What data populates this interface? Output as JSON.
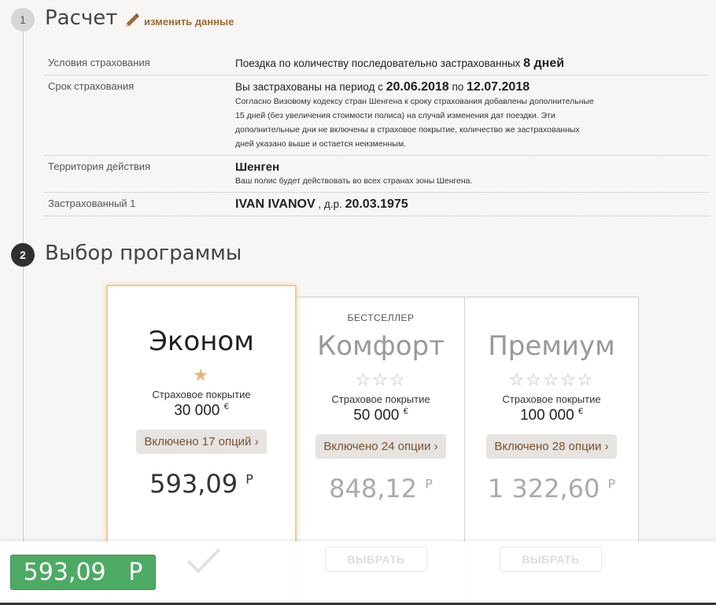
{
  "step1": {
    "number": "1",
    "title": "Расчет",
    "edit_label": "изменить данные"
  },
  "info": {
    "conditions": {
      "label": "Условия страхования",
      "text": "Поездка по количеству последовательно застрахованных",
      "days": "8 дней"
    },
    "period": {
      "label": "Срок страхования",
      "prefix": "Вы застрахованы на период с",
      "from": "20.06.2018",
      "mid": "по",
      "to": "12.07.2018",
      "note": "Согласно Визовому кодексу стран Шенгена к сроку страхования добавлены дополнительные 15 дней (без увеличения стоимости полиса) на случай изменения дат поездки. Эти дополнительные дни не включены в страховое покрытие, количество же застрахованных дней указано выше и остается неизменным."
    },
    "territory": {
      "label": "Территория действия",
      "value": "Шенген",
      "note": "Ваш полис будет действовать во всех странах зоны Шенгена."
    },
    "insured": {
      "label": "Застрахованный 1",
      "name": "IVAN IVANOV",
      "dob_label": ", д.р.",
      "dob": "20.03.1975"
    }
  },
  "step2": {
    "number": "2",
    "title": "Выбор программы"
  },
  "programs": [
    {
      "badge": "",
      "name": "Эконом",
      "stars_filled": 1,
      "stars_total": 1,
      "coverage_label": "Страховое покрытие",
      "coverage": "30 000",
      "currency": "€",
      "options": "Включено 17 опций ›",
      "price": "593,09",
      "price_currency": "Р",
      "selected": true
    },
    {
      "badge": "БЕСТСЕЛЛЕР",
      "name": "Комфорт",
      "stars_filled": 0,
      "stars_total": 3,
      "coverage_label": "Страховое покрытие",
      "coverage": "50 000",
      "currency": "€",
      "options": "Включено 24 опции ›",
      "price": "848,12",
      "price_currency": "Р",
      "select_label": "ВЫБРАТЬ",
      "selected": false
    },
    {
      "badge": "",
      "name": "Премиум",
      "stars_filled": 0,
      "stars_total": 5,
      "coverage_label": "Страховое покрытие",
      "coverage": "100 000",
      "currency": "€",
      "options": "Включено 28 опции ›",
      "price": "1 322,60",
      "price_currency": "Р",
      "select_label": "ВЫБРАТЬ",
      "selected": false
    }
  ],
  "total": {
    "amount": "593,09",
    "currency": "Р"
  },
  "icons": {
    "edit": "pencil-icon",
    "selected": "check-icon",
    "star_full": "star-filled-icon",
    "star_empty": "star-outline-icon"
  },
  "colors": {
    "accent": "#9b6a37",
    "total_bg": "#4daa64",
    "star": "#e7b575",
    "selected_border": "#f0c99a"
  }
}
